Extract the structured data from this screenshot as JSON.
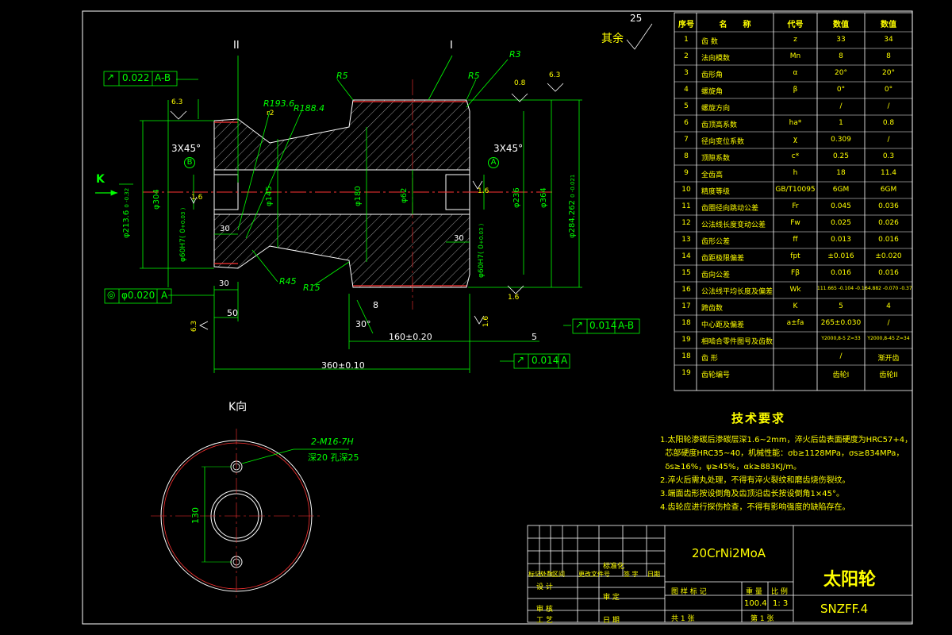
{
  "drawing": {
    "roughness_other": "其余",
    "roughness_main": "25",
    "section_I": "I",
    "section_II": "II",
    "view_arrow": "K",
    "view_label": "K向",
    "fcf_top": {
      "symbol": "↗",
      "value": "0.022",
      "datum": "A-B"
    },
    "fcf_left": {
      "symbol": "◎",
      "value": "φ0.020",
      "datum": "A"
    },
    "fcf_right": {
      "symbol": "↗",
      "value": "0.014",
      "datum": "A-B"
    },
    "fcf_bottom": {
      "symbol": "↗",
      "value": "0.014",
      "datum": "A"
    },
    "radii": {
      "R5a": "R5",
      "R5b": "R5",
      "R3": "R3",
      "R193": "R193.6",
      "R188": "R188.4",
      "R45": "R45",
      "R15": "R15",
      "r2": "r2"
    },
    "roughness": {
      "r1": "6.3",
      "r2": "0.8",
      "r3": "6.3",
      "r4": "1.6",
      "r5": "1.6",
      "r6": "6.3",
      "r7": "1.6",
      "r8": "1.6"
    },
    "dims": {
      "chamfer_left": "3X45°",
      "chamfer_right": "3X45°",
      "d_left_od": "φ213.6",
      "d_left_tol": "0 -0.32",
      "d_304": "φ304",
      "d_145": "φ145",
      "d_180": "φ180",
      "d_62": "φ62",
      "d_236": "φ236",
      "d_364": "φ364",
      "d_right_od": "φ284.262",
      "d_right_tol": "0 -0.021",
      "bore_left": "φ60H7( 0",
      "bore_left_tol": "+0.03 )",
      "bore_right": "φ60H7( 0",
      "bore_right_tol": "+0.03 )",
      "l_30a": "30",
      "l_30b": "30",
      "l_30c": "30",
      "l_50": "50",
      "l_8": "8",
      "l_30deg": "30°",
      "l_160": "160±0.20",
      "l_5": "5",
      "l_360": "360±0.10",
      "datum_A": "A",
      "datum_B": "B"
    },
    "kview": {
      "hole_note1": "2-M16-7H",
      "hole_note2": "深20 孔深25",
      "dim_130": "130"
    }
  },
  "table": {
    "headers": [
      "序号",
      "名　　称",
      "代号",
      "数值",
      "数值"
    ],
    "rows": [
      [
        "1",
        "齿 数",
        "z",
        "33",
        "34"
      ],
      [
        "2",
        "法向模数",
        "Mn",
        "8",
        "8"
      ],
      [
        "3",
        "齿形角",
        "α",
        "20°",
        "20°"
      ],
      [
        "4",
        "螺旋角",
        "β",
        "0°",
        "0°"
      ],
      [
        "5",
        "螺旋方向",
        "",
        "/",
        "/"
      ],
      [
        "6",
        "齿顶高系数",
        "ha*",
        "1",
        "0.8"
      ],
      [
        "7",
        "径向变位系数",
        "χ",
        "0.309",
        "/"
      ],
      [
        "8",
        "顶隙系数",
        "c*",
        "0.25",
        "0.3"
      ],
      [
        "9",
        "全齿高",
        "h",
        "18",
        "11.4"
      ],
      [
        "10",
        "精度等级",
        "GB/T10095",
        "6GM",
        "6GM"
      ],
      [
        "11",
        "齿圈径向跳动公差",
        "Fr",
        "0.045",
        "0.036"
      ],
      [
        "12",
        "公法线长度变动公差",
        "Fw",
        "0.025",
        "0.026"
      ],
      [
        "13",
        "齿形公差",
        "ff",
        "0.013",
        "0.016"
      ],
      [
        "14",
        "齿距极限偏差",
        "fpt",
        "±0.016",
        "±0.020"
      ],
      [
        "15",
        "齿向公差",
        "Fβ",
        "0.016",
        "0.016"
      ],
      [
        "16",
        "公法线平均长度及偏差",
        "Wk",
        "111.665 -0.104 -0.162",
        "64.882 -0.070 -0.378"
      ],
      [
        "17",
        "跨齿数",
        "K",
        "5",
        "4"
      ],
      [
        "18",
        "中心距及偏差",
        "a±fa",
        "265±0.030",
        "/"
      ],
      [
        "19",
        "相啮合零件图号及齿数",
        "",
        "Y2000,8-5 Z=33",
        "Y2000,8-45 Z=34"
      ],
      [
        "18",
        "齿 形",
        "",
        "/",
        "渐开齿"
      ],
      [
        "19",
        "齿轮编号",
        "",
        "齿轮I",
        "齿轮II"
      ]
    ]
  },
  "notes": {
    "title": "技术要求",
    "items": [
      "1.太阳轮渗碳后渗碳层深1.6~2mm，淬火后齿表面硬度为HRC57+4，",
      "  芯部硬度HRC35~40，机械性能：σb≥1128MPa，σs≥834MPa，",
      "  δs≥16%，ψ≥45%，αk≥883KJ/m。",
      "2.淬火后需丸处理，不得有淬火裂纹和磨齿烧伤裂纹。",
      "3.端面齿形按设倒角及齿顶沿齿长按设倒角1×45°。",
      "4.齿轮应进行探伤检查，不得有影响强度的缺陷存在。"
    ]
  },
  "title_block": {
    "material": "20CrNi2MoA",
    "part_name": "太阳轮",
    "drawing_no": "SNZFF.4",
    "rev_headers": [
      "标记",
      "处数",
      "区间",
      "更改文件号",
      "签 字",
      "日期"
    ],
    "roles": [
      "设 计",
      "审 核",
      "工 艺"
    ],
    "std_label": "标准化",
    "approve_label": "审 定",
    "date_label": "日 期",
    "stage_label": "图 样 标 记",
    "weight_label": "重 量",
    "scale_label": "比 例",
    "weight": "100.4",
    "scale": "1: 3",
    "total_label": "共 1 张",
    "sheet_label": "第 1 张"
  }
}
